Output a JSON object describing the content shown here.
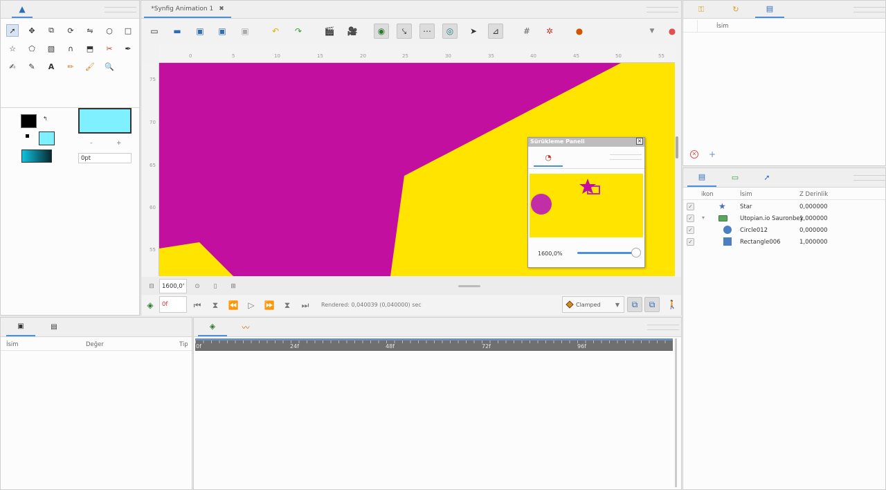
{
  "document_tab": {
    "title": "*Synfig Animation 1",
    "close": "✖"
  },
  "toolbox": {
    "tools": [
      "transform",
      "smooth-move",
      "scale",
      "rotate",
      "mirror",
      "circle",
      "rectangle",
      "star",
      "polygon",
      "gradient",
      "spline",
      "fill",
      "cutout",
      "draw",
      "sketch",
      "eyedrop",
      "text",
      "width",
      "brush",
      "zoom"
    ]
  },
  "fill_panel": {
    "width_value": "0pt",
    "minus": "-",
    "plus": "+"
  },
  "colors": {
    "outline": "#000000",
    "fill": "#7ff0ff",
    "gradient_start": "#0fc4e0",
    "gradient_end": "#082830",
    "canvas_bg": "#ffe400",
    "magenta": "#c20f9f",
    "accent": "#4a90d9"
  },
  "ruler": {
    "h_ticks": [
      "0",
      "5",
      "10",
      "15",
      "20",
      "25",
      "30",
      "35",
      "40",
      "45",
      "50",
      "55"
    ],
    "v_ticks": [
      "75",
      "70",
      "65",
      "60",
      "55"
    ]
  },
  "canvas_bottom": {
    "zoom_value": "1600,0°"
  },
  "timebar": {
    "frame": "0f",
    "status": "Rendered: 0,040039 (0,040000) sec",
    "interpolation": "Clamped"
  },
  "navigator": {
    "title": "Sürükleme Paneli",
    "zoom_label": "1600,0%",
    "zoom_fraction": 0.98
  },
  "params_panel": {
    "col_name": "İsim",
    "col_value": "Değer",
    "col_type": "Tip"
  },
  "timetrack": {
    "marks": [
      "0f",
      "24f",
      "48f",
      "72f",
      "96f"
    ]
  },
  "library_panel": {
    "col_name": "İsim"
  },
  "layers_panel": {
    "col_icon": "ikon",
    "col_name": "İsim",
    "col_z": "Z Derinlik",
    "layers": [
      {
        "name": "Star",
        "z": "0,000000",
        "icon": "star-icon",
        "indent": 0,
        "expander": ""
      },
      {
        "name": "Utopian.io Sauronbey",
        "z": "1,000000",
        "icon": "folder-icon",
        "indent": 0,
        "expander": "▾"
      },
      {
        "name": "Circle012",
        "z": "0,000000",
        "icon": "circle-icon",
        "indent": 1,
        "expander": ""
      },
      {
        "name": "Rectangle006",
        "z": "1,000000",
        "icon": "rectangle-icon",
        "indent": 1,
        "expander": ""
      }
    ]
  }
}
